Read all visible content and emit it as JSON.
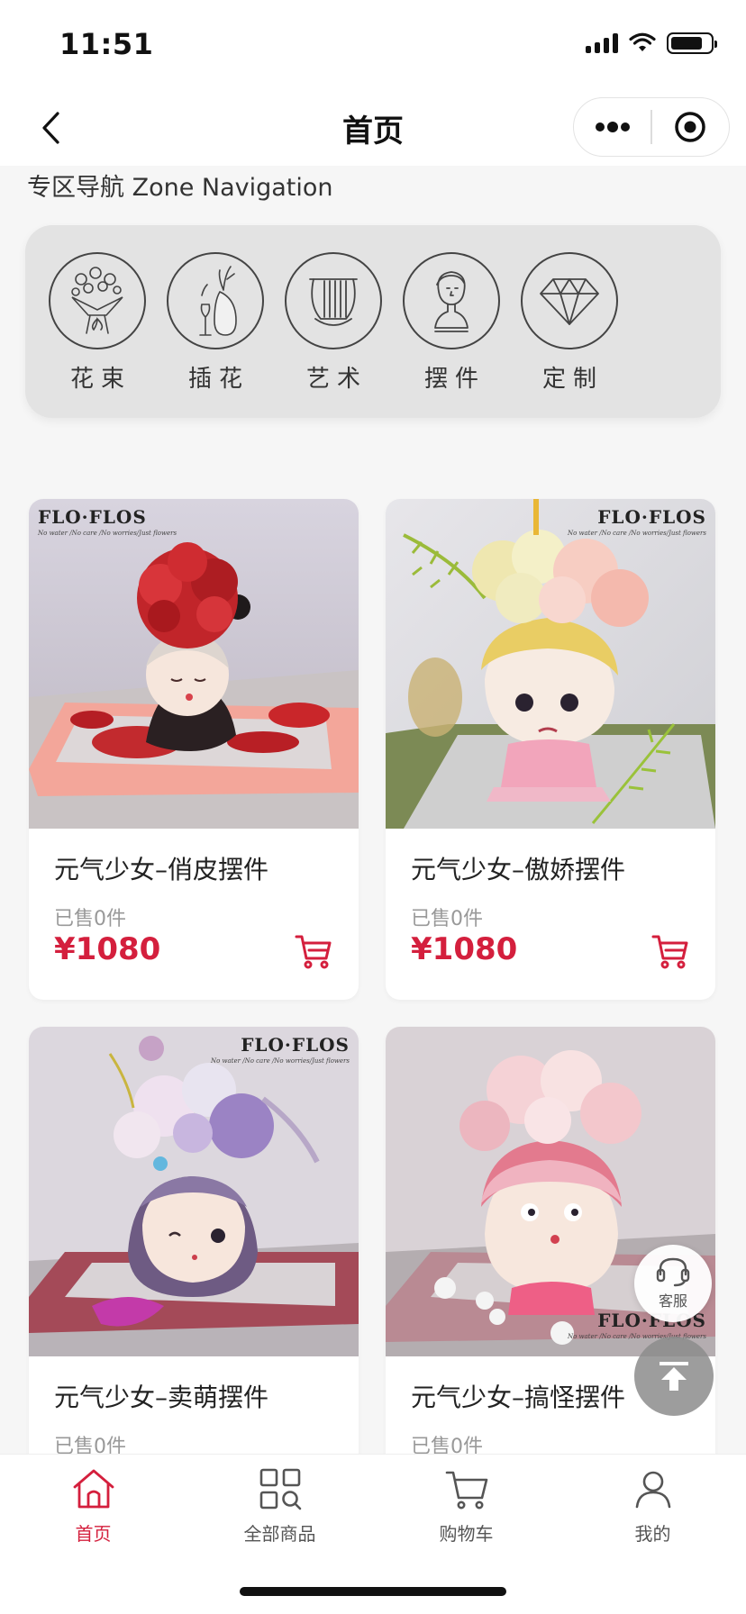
{
  "status_bar": {
    "time": "11:51"
  },
  "nav": {
    "title": "首页"
  },
  "zones": {
    "heading": "专区导航 Zone Navigation",
    "items": [
      {
        "label": "花束",
        "icon": "bouquet-icon"
      },
      {
        "label": "插花",
        "icon": "vase-icon"
      },
      {
        "label": "艺术",
        "icon": "lyre-icon"
      },
      {
        "label": "摆件",
        "icon": "bust-icon"
      },
      {
        "label": "定制",
        "icon": "diamond-icon"
      }
    ]
  },
  "products": [
    {
      "name": "元气少女–俏皮摆件",
      "sold": "已售0件",
      "price": "¥1080",
      "brand": "FLO·FLOS",
      "brand_sub": "No water /No care /No worries/Just flowers"
    },
    {
      "name": "元气少女–傲娇摆件",
      "sold": "已售0件",
      "price": "¥1080",
      "brand": "FLO·FLOS",
      "brand_sub": "No water /No care /No worries/Just flowers"
    },
    {
      "name": "元气少女–卖萌摆件",
      "sold": "已售0件",
      "brand": "FLO·FLOS",
      "brand_sub": "No water /No care /No worries/Just flowers"
    },
    {
      "name": "元气少女–搞怪摆件",
      "sold": "已售0件",
      "brand": "FLO·FLOS",
      "brand_sub": "No water /No care /No worries/Just flowers"
    }
  ],
  "floating": {
    "customer_service": "客服"
  },
  "tabs": [
    {
      "label": "首页",
      "active": true
    },
    {
      "label": "全部商品"
    },
    {
      "label": "购物车"
    },
    {
      "label": "我的"
    }
  ],
  "colors": {
    "accent": "#d41f3d",
    "zone_bg": "#e3e3e3",
    "page_bg": "#f6f6f6"
  }
}
